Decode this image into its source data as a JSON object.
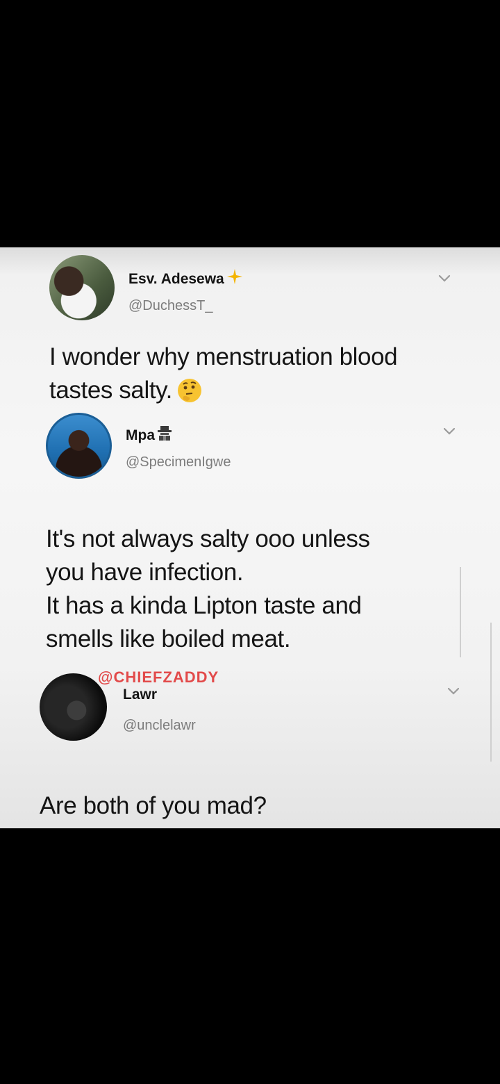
{
  "tweets": [
    {
      "display_name": "Esv. Adesewa",
      "name_decoration": "sparkle-icon",
      "handle": "@DuchessT_",
      "text_lines": [
        "I wonder why menstruation blood",
        "tastes salty."
      ],
      "trailing_emoji": "thinking-face-icon"
    },
    {
      "display_name": "Mpa",
      "name_decoration": "detective-icon",
      "handle": "@SpecimenIgwe",
      "text_lines": [
        "It's not always salty ooo unless",
        "you have infection.",
        "It has a kinda Lipton taste and",
        "smells like boiled meat."
      ]
    },
    {
      "display_name": "Lawr",
      "handle": "@unclelawr",
      "text_lines": [
        "Are both of you mad?"
      ]
    }
  ],
  "watermark": "@CHIEFZADDY",
  "colors": {
    "background": "#000000",
    "card": "#f4f4f4",
    "text": "#151515",
    "handle": "#7c7c7c",
    "watermark": "#e24a4a",
    "sparkle": "#f4b400"
  }
}
